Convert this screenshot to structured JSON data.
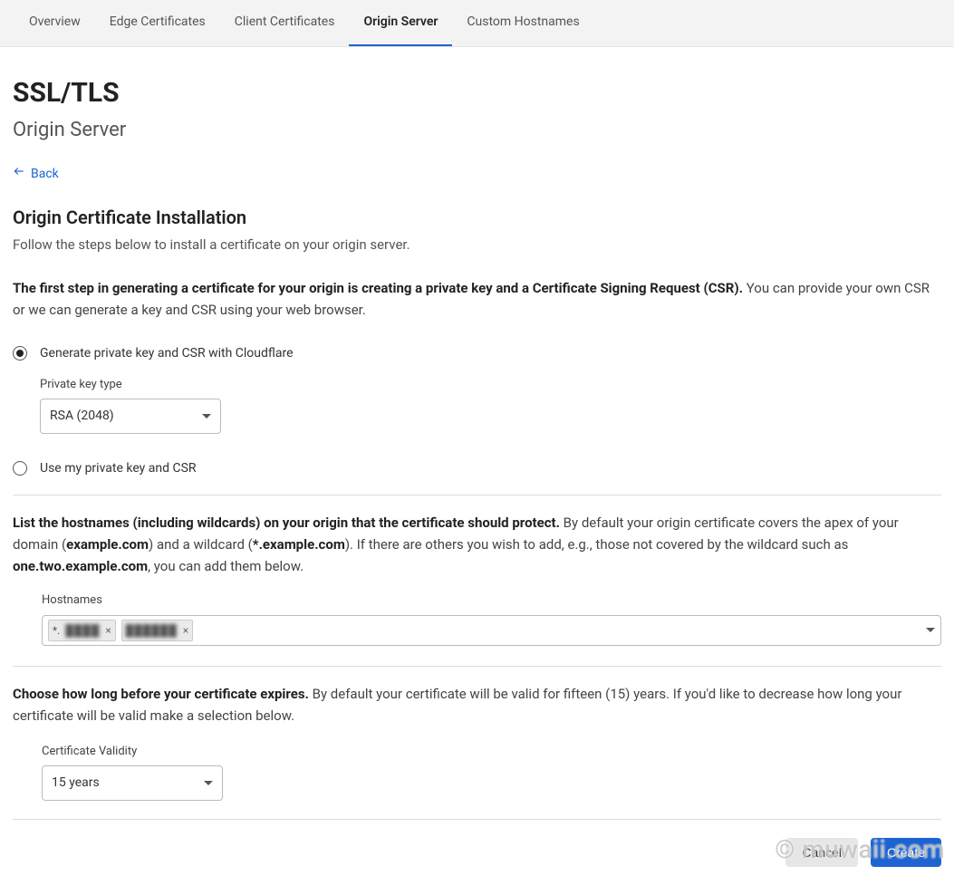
{
  "tabs": {
    "items": [
      {
        "label": "Overview"
      },
      {
        "label": "Edge Certificates"
      },
      {
        "label": "Client Certificates"
      },
      {
        "label": "Origin Server"
      },
      {
        "label": "Custom Hostnames"
      }
    ],
    "activeIndex": 3
  },
  "header": {
    "title": "SSL/TLS",
    "subtitle": "Origin Server"
  },
  "back": {
    "label": "Back"
  },
  "install": {
    "title": "Origin Certificate Installation",
    "desc": "Follow the steps below to install a certificate on your origin server."
  },
  "csr": {
    "lead_bold": "The first step in generating a certificate for your origin is creating a private key and a Certificate Signing Request (CSR).",
    "lead_rest": " You can provide your own CSR or we can generate a key and CSR using your web browser."
  },
  "radio": {
    "opt1_label": "Generate private key and CSR with Cloudflare",
    "opt2_label": "Use my private key and CSR"
  },
  "keytype": {
    "label": "Private key type",
    "value": "RSA (2048)"
  },
  "hostnames_para": {
    "p1_bold": "List the hostnames (including wildcards) on your origin that the certificate should protect.",
    "p1_t1": " By default your origin certificate covers the apex of your domain (",
    "p1_b1": "example.com",
    "p1_t2": ") and a wildcard (",
    "p1_b2": "*.example.com",
    "p1_t3": "). If there are others you wish to add, e.g., those not covered by the wildcard such as ",
    "p1_b3": "one.two.example.com",
    "p1_t4": ", you can add them below."
  },
  "hostnames_field": {
    "label": "Hostnames",
    "chip1_prefix": "*.",
    "chip1_blur": "████",
    "chip2_blur": "██████"
  },
  "validity_para": {
    "bold": "Choose how long before your certificate expires.",
    "rest": " By default your certificate will be valid for fifteen (15) years. If you'd like to decrease how long your certificate will be valid make a selection below."
  },
  "validity_field": {
    "label": "Certificate Validity",
    "value": "15 years"
  },
  "actions": {
    "cancel": "Cancel",
    "create": "Create"
  },
  "watermark": "© muwaii.com"
}
